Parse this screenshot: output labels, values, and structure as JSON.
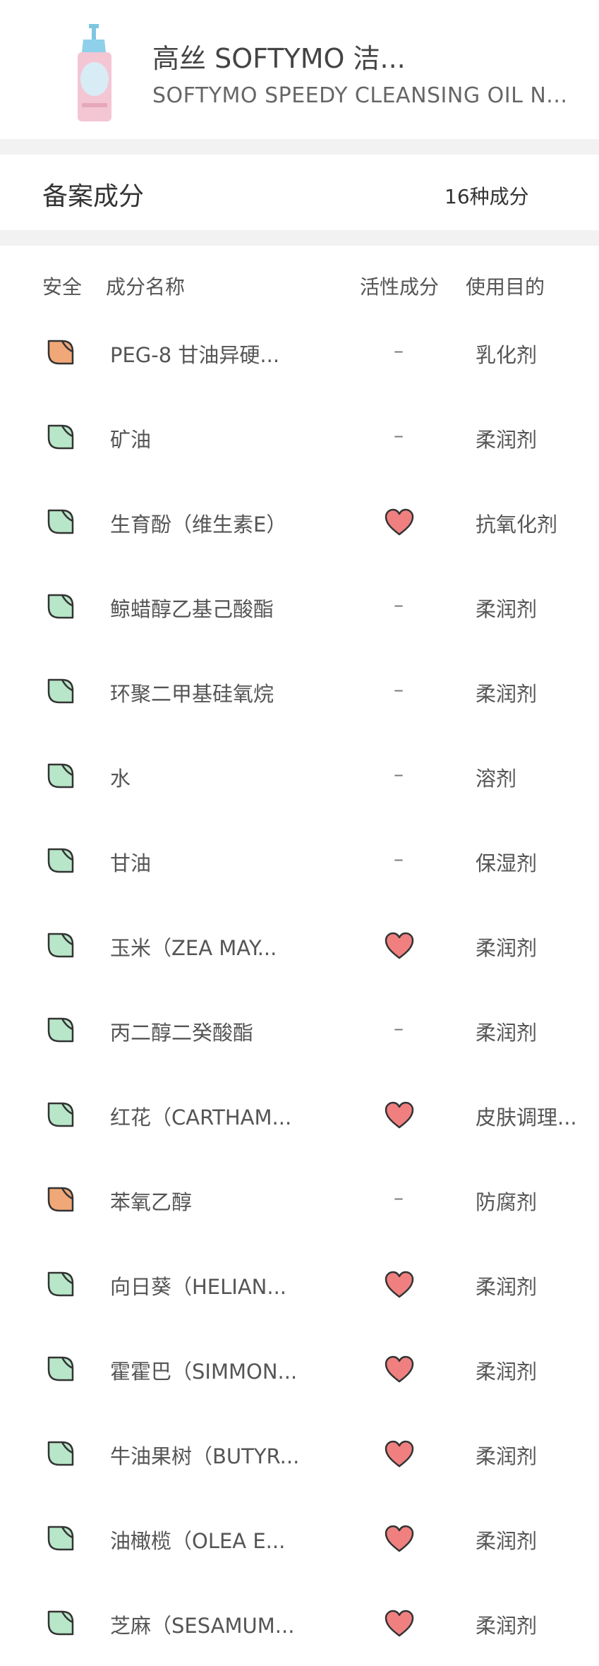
{
  "product": {
    "title": "高丝 SOFTYMO 洁...",
    "subtitle": "SOFTYMO SPEEDY CLEANSING OIL N..."
  },
  "section": {
    "title": "备案成分",
    "count": "16种成分"
  },
  "columns": {
    "safety": "安全",
    "name": "成分名称",
    "active": "活性成分",
    "purpose": "使用目的"
  },
  "colors": {
    "leaf_green": "#b8e6c8",
    "leaf_orange": "#f0a878",
    "heart_red": "#f08080",
    "divider": "#f2f2f2"
  },
  "ingredients": [
    {
      "safety": "orange",
      "name": "PEG-8 甘油异硬...",
      "active": false,
      "dash": "–",
      "purpose": "乳化剂"
    },
    {
      "safety": "green",
      "name": "矿油",
      "active": false,
      "dash": "–",
      "purpose": "柔润剂"
    },
    {
      "safety": "green",
      "name": "生育酚（维生素E）",
      "active": true,
      "dash": "",
      "purpose": "抗氧化剂"
    },
    {
      "safety": "green",
      "name": "鲸蜡醇乙基己酸酯",
      "active": false,
      "dash": "–",
      "purpose": "柔润剂"
    },
    {
      "safety": "green",
      "name": "环聚二甲基硅氧烷",
      "active": false,
      "dash": "–",
      "purpose": "柔润剂"
    },
    {
      "safety": "green",
      "name": "水",
      "active": false,
      "dash": "–",
      "purpose": "溶剂"
    },
    {
      "safety": "green",
      "name": "甘油",
      "active": false,
      "dash": "–",
      "purpose": "保湿剂"
    },
    {
      "safety": "green",
      "name": "玉米（ZEA MAY...",
      "active": true,
      "dash": "",
      "purpose": "柔润剂"
    },
    {
      "safety": "green",
      "name": "丙二醇二癸酸酯",
      "active": false,
      "dash": "–",
      "purpose": "柔润剂"
    },
    {
      "safety": "green",
      "name": "红花（CARTHAM...",
      "active": true,
      "dash": "",
      "purpose": "皮肤调理..."
    },
    {
      "safety": "orange",
      "name": "苯氧乙醇",
      "active": false,
      "dash": "–",
      "purpose": "防腐剂"
    },
    {
      "safety": "green",
      "name": "向日葵（HELIAN...",
      "active": true,
      "dash": "",
      "purpose": "柔润剂"
    },
    {
      "safety": "green",
      "name": "霍霍巴（SIMMON...",
      "active": true,
      "dash": "",
      "purpose": "柔润剂"
    },
    {
      "safety": "green",
      "name": "牛油果树（BUTYR...",
      "active": true,
      "dash": "",
      "purpose": "柔润剂"
    },
    {
      "safety": "green",
      "name": "油橄榄（OLEA E...",
      "active": true,
      "dash": "",
      "purpose": "柔润剂"
    },
    {
      "safety": "green",
      "name": "芝麻（SESAMUM...",
      "active": true,
      "dash": "",
      "purpose": "柔润剂"
    }
  ]
}
